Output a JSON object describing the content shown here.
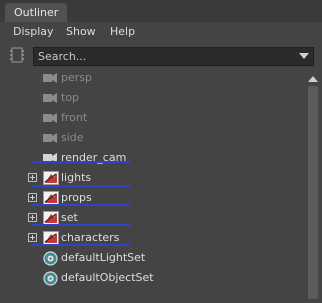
{
  "tab": {
    "label": "Outliner"
  },
  "menu": [
    "Display",
    "Show",
    "Help"
  ],
  "search": {
    "placeholder": "Search..."
  },
  "outliner": {
    "items": [
      {
        "label": "persp",
        "icon": "camera-icon",
        "style": "dim"
      },
      {
        "label": "top",
        "icon": "camera-icon",
        "style": "dim"
      },
      {
        "label": "front",
        "icon": "camera-icon",
        "style": "dim"
      },
      {
        "label": "side",
        "icon": "camera-icon",
        "style": "dim"
      },
      {
        "label": "render_cam",
        "icon": "camera-icon",
        "style": "bright"
      },
      {
        "label": "lights",
        "icon": "group-icon",
        "expandable": true
      },
      {
        "label": "props",
        "icon": "group-icon",
        "expandable": true
      },
      {
        "label": "set",
        "icon": "group-icon",
        "expandable": true
      },
      {
        "label": "characters",
        "icon": "group-icon",
        "expandable": true
      },
      {
        "label": "defaultLightSet",
        "icon": "object-set-icon"
      },
      {
        "label": "defaultObjectSet",
        "icon": "object-set-icon"
      }
    ]
  },
  "colors": {
    "annotation_underline": "#2d43c8",
    "panel_bg": "#444444"
  }
}
